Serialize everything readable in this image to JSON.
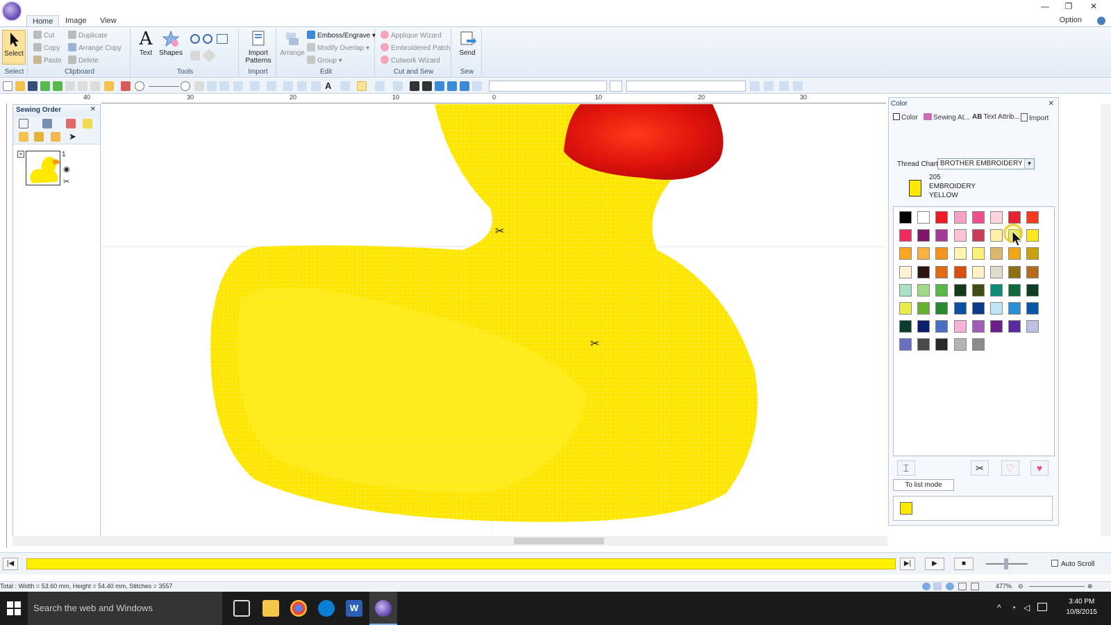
{
  "window": {
    "option_label": "Option"
  },
  "ribbon_tabs": [
    "Home",
    "Image",
    "View"
  ],
  "ribbon": {
    "select": {
      "button": "Select",
      "group": "Select"
    },
    "clipboard": {
      "cut": "Cut",
      "copy": "Copy",
      "paste": "Paste",
      "duplicate": "Duplicate",
      "arrange_copy": "Arrange Copy",
      "delete": "Delete",
      "group": "Clipboard"
    },
    "tools": {
      "text": "Text",
      "shapes": "Shapes",
      "group": "Tools"
    },
    "import": {
      "button": "Import Patterns",
      "group": "Import"
    },
    "edit": {
      "arrange": "Arrange",
      "emboss": "Emboss/Engrave",
      "modify_overlap": "Modify Overlap",
      "group_btn": "Group",
      "group": "Edit"
    },
    "cut_and_sew": {
      "applique": "Applique Wizard",
      "patch": "Embroidered Patch",
      "cutwork": "Cutwork Wizard",
      "group": "Cut and Sew"
    },
    "sew": {
      "send": "Send",
      "group": "Sew"
    }
  },
  "ruler_labels": [
    "40",
    "30",
    "20",
    "10",
    "0",
    "10",
    "20",
    "30"
  ],
  "sewing_order": {
    "title": "Sewing Order",
    "item_number": "1"
  },
  "color_panel": {
    "title": "Color",
    "tabs": [
      "Color",
      "Sewing At...",
      "Text Attrib...",
      "Import"
    ],
    "thread_chart_label": "Thread Chart:",
    "thread_chart_value": "BROTHER EMBROIDERY",
    "current_thread": {
      "code": "205",
      "name_line1": "EMBROIDERY",
      "name_line2": "YELLOW",
      "color": "#ffe800"
    },
    "to_list_mode": "To list mode",
    "palette": [
      [
        "#000000",
        "#ffffff",
        "#ee1c24",
        "#f7a1c4",
        "#f0508a",
        "#fbd6dc",
        "#e8222e",
        "#f23a1d"
      ],
      [
        "#ec2c63",
        "#7d1769",
        "#a33a96",
        "#f8c4d4",
        "#c93b57",
        "#fff1a8",
        "#d8e86a",
        "#ffe81e"
      ],
      [
        "#f9a620",
        "#f9b142",
        "#f7941d",
        "#fff4b0",
        "#fff07a",
        "#ddb56b",
        "#f2a614",
        "#c9a00f"
      ],
      [
        "#fdf2d2",
        "#2b1512",
        "#e06a16",
        "#d94f12",
        "#fff3c6",
        "#e2dccf",
        "#8d7010",
        "#b46b1b"
      ],
      [
        "#a9e0c4",
        "#a2d889",
        "#5bb74a",
        "#123a1a",
        "#3f4d14",
        "#0d8d78",
        "#0c6a3c",
        "#0b3f24"
      ],
      [
        "#e8ee46",
        "#66b032",
        "#2a8a31",
        "#0c4fa2",
        "#0c3a8a",
        "#bfe6f2",
        "#2b8fd6",
        "#0a56a6"
      ],
      [
        "#0b3c32",
        "#0b1e6e",
        "#4a6fc2",
        "#f8b2d8",
        "#a15cb8",
        "#6b1f8c",
        "#5a2b9e",
        "#bcc1e4"
      ],
      [
        "#6a6fbf",
        "#4a4a4a",
        "#2b2b2b",
        "#b5b5b5",
        "#8c8c8c"
      ]
    ]
  },
  "playback": {
    "auto_scroll": "Auto Scroll"
  },
  "status": {
    "text": "Total : Width = 53.60 mm, Height = 54.40 mm, Stitches = 3557",
    "zoom": "477%"
  },
  "taskbar": {
    "search_placeholder": "Search the web and Windows",
    "time": "3:40 PM",
    "date": "10/8/2015"
  }
}
